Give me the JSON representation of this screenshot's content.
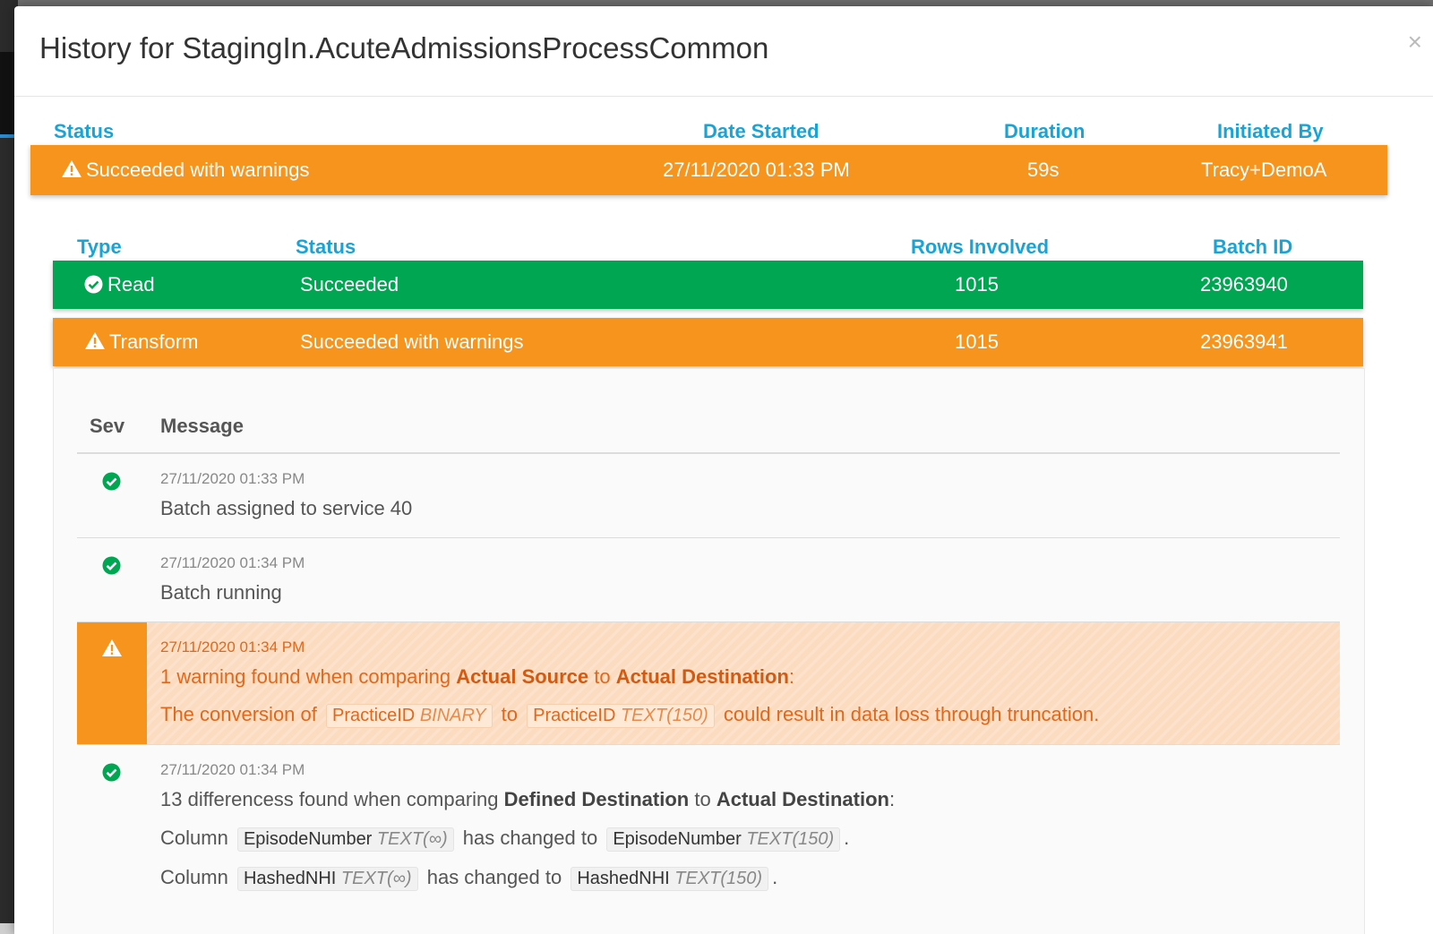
{
  "modal": {
    "title": "History for StagingIn.AcuteAdmissionsProcessCommon",
    "close_glyph": "×"
  },
  "summary": {
    "headers": {
      "status": "Status",
      "date_started": "Date Started",
      "duration": "Duration",
      "initiated_by": "Initiated By"
    },
    "row": {
      "status": "Succeeded with warnings",
      "date_started": "27/11/2020 01:33 PM",
      "duration": "59s",
      "initiated_by": "Tracy+DemoA",
      "color": "#f7941d",
      "icon": "warning-icon"
    }
  },
  "steps": {
    "headers": {
      "type": "Type",
      "status": "Status",
      "rows": "Rows Involved",
      "batch": "Batch ID"
    },
    "rows": [
      {
        "type": "Read",
        "status": "Succeeded",
        "rows": "1015",
        "batch": "23963940",
        "color": "#00a651",
        "icon": "check-circle-icon"
      },
      {
        "type": "Transform",
        "status": "Succeeded with warnings",
        "rows": "1015",
        "batch": "23963941",
        "color": "#f7941d",
        "icon": "warning-icon"
      }
    ]
  },
  "messages": {
    "headers": {
      "sev": "Sev",
      "message": "Message"
    },
    "items": [
      {
        "time": "27/11/2020 01:33 PM",
        "text": "Batch assigned to service 40",
        "severity": "success"
      },
      {
        "time": "27/11/2020 01:34 PM",
        "text": "Batch running",
        "severity": "success"
      },
      {
        "time": "27/11/2020 01:34 PM",
        "severity": "warning",
        "line1": {
          "prefix": "1 warning found when comparing",
          "source": "Actual Source",
          "to": "to",
          "dest": "Actual Destination",
          "suffix": ":"
        },
        "line2": {
          "prefix": "The conversion of",
          "from_name": "PracticeID",
          "from_type": "BINARY",
          "to": "to",
          "to_name": "PracticeID",
          "to_type": "TEXT(150)",
          "suffix": "could result in data loss through truncation."
        }
      },
      {
        "time": "27/11/2020 01:34 PM",
        "severity": "success",
        "line1": {
          "prefix": "13 differencess found when comparing",
          "source": "Defined Destination",
          "to": "to",
          "dest": "Actual Destination",
          "suffix": ":"
        },
        "changes": [
          {
            "column": "Column",
            "from_name": "EpisodeNumber",
            "from_type": "TEXT(∞)",
            "changed": "has changed to",
            "to_name": "EpisodeNumber",
            "to_type": "TEXT(150)",
            "end": "."
          },
          {
            "column": "Column",
            "from_name": "HashedNHI",
            "from_type": "TEXT(∞)",
            "changed": "has changed to",
            "to_name": "HashedNHI",
            "to_type": "TEXT(150)",
            "end": "."
          }
        ]
      }
    ]
  },
  "colors": {
    "accent_blue": "#1aa3d4",
    "success_green": "#00a651",
    "warning_orange": "#f7941d",
    "warning_text": "#e0681c"
  }
}
